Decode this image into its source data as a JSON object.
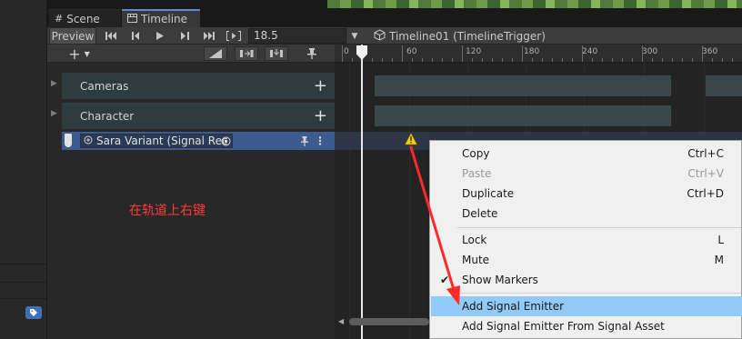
{
  "tabs": [
    {
      "label": "Scene",
      "icon": "hash-icon"
    },
    {
      "label": "Timeline",
      "icon": "timeline-icon"
    }
  ],
  "toolbar": {
    "preview_label": "Preview",
    "frame_value": "18.5",
    "asset_label": "Timeline01 (TimelineTrigger)"
  },
  "ruler": {
    "labels": [
      "0",
      "60",
      "120",
      "180",
      "240",
      "300",
      "360"
    ]
  },
  "tracks": [
    {
      "label": "Cameras"
    },
    {
      "label": "Character"
    }
  ],
  "signal_track": {
    "field_text": "Sara Variant (Signal Rec"
  },
  "annotation": "在轨道上右键",
  "context_menu": {
    "items": [
      {
        "label": "Copy",
        "shortcut": "Ctrl+C",
        "enabled": true
      },
      {
        "label": "Paste",
        "shortcut": "Ctrl+V",
        "enabled": false
      },
      {
        "label": "Duplicate",
        "shortcut": "Ctrl+D",
        "enabled": true
      },
      {
        "label": "Delete",
        "shortcut": "",
        "enabled": true
      },
      {
        "label": "Lock",
        "shortcut": "L",
        "enabled": true
      },
      {
        "label": "Mute",
        "shortcut": "M",
        "enabled": true
      },
      {
        "label": "Show Markers",
        "shortcut": "",
        "enabled": true,
        "checked": true
      },
      {
        "label": "Add Signal Emitter",
        "shortcut": "",
        "enabled": true,
        "highlighted": true
      },
      {
        "label": "Add Signal Emitter From Signal Asset",
        "shortcut": "",
        "enabled": true
      }
    ]
  },
  "colors": {
    "accent": "#5a8ad6",
    "signal_track": "#3c5b8f",
    "menu_highlight": "#91c9f7",
    "annotation": "#ff3b3b"
  }
}
